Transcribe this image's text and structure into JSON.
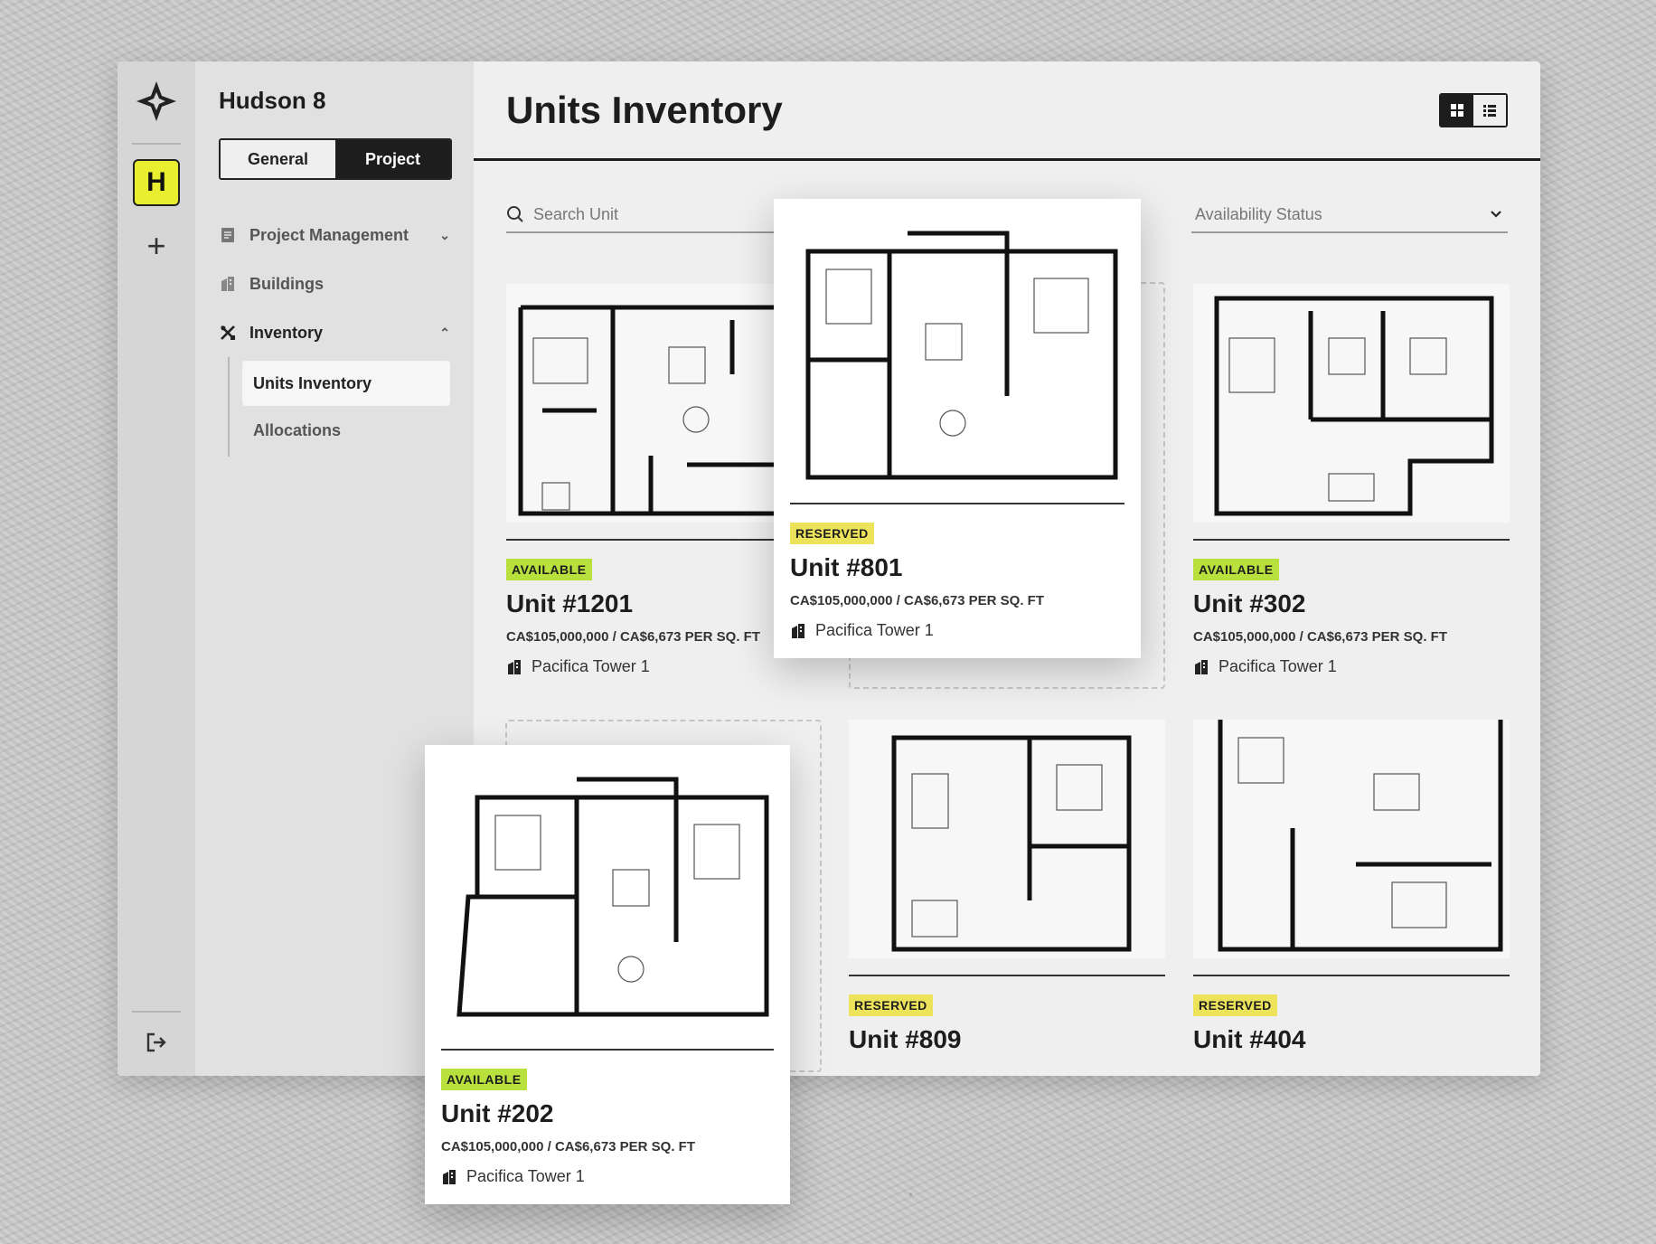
{
  "project": {
    "name": "Hudson 8",
    "badge": "H"
  },
  "tabs": [
    {
      "label": "General"
    },
    {
      "label": "Project"
    }
  ],
  "nav": {
    "project_management": "Project Management",
    "buildings": "Buildings",
    "inventory": "Inventory",
    "sub": [
      {
        "label": "Units Inventory"
      },
      {
        "label": "Allocations"
      }
    ]
  },
  "main": {
    "title": "Units Inventory",
    "search_placeholder": "Search Unit",
    "filter_label": "Availability Status"
  },
  "units": [
    {
      "status": "AVAILABLE",
      "name": "Unit #1201",
      "price": "CA$105,000,000",
      "per_sqft": "CA$6,673 PER SQ. FT",
      "tower": "Pacifica Tower 1"
    },
    {
      "status": "RESERVED",
      "name": "Unit #801",
      "price": "CA$105,000,000",
      "per_sqft": "CA$6,673 PER SQ. FT",
      "tower": "Pacifica Tower 1"
    },
    {
      "status": "AVAILABLE",
      "name": "Unit #302",
      "price": "CA$105,000,000",
      "per_sqft": "CA$6,673 PER SQ. FT",
      "tower": "Pacifica Tower 1"
    },
    {
      "status": "AVAILABLE",
      "name": "Unit #202",
      "price": "CA$105,000,000",
      "per_sqft": "CA$6,673 PER SQ. FT",
      "tower": "Pacifica Tower 1"
    },
    {
      "status": "RESERVED",
      "name": "Unit #809"
    },
    {
      "status": "RESERVED",
      "name": "Unit #404"
    }
  ],
  "colors": {
    "available": "#b9e13d",
    "reserved": "#ede35a",
    "badge": "#e9ef2f"
  },
  "icons": [
    "brand-logo-icon",
    "plus-icon",
    "logout-icon",
    "document-icon",
    "building-icon",
    "tools-icon",
    "grid-view-icon",
    "list-view-icon",
    "search-icon",
    "chevron-down-icon"
  ]
}
